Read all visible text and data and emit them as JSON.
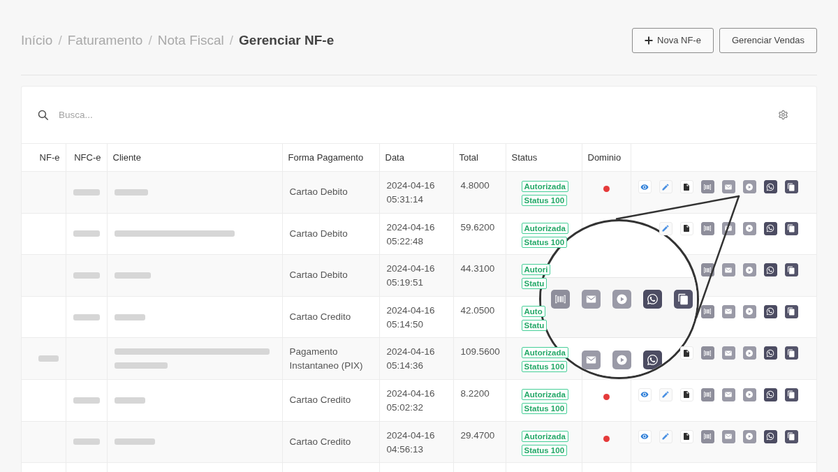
{
  "breadcrumb": [
    {
      "label": "Início",
      "current": false
    },
    {
      "label": "Faturamento",
      "current": false
    },
    {
      "label": "Nota Fiscal",
      "current": false
    },
    {
      "label": "Gerenciar NF-e",
      "current": true
    }
  ],
  "breadcrumb_separator": "/",
  "header_buttons": [
    {
      "kind": "add",
      "label": "Nova NF-e"
    },
    {
      "kind": "plain",
      "label": "Gerenciar Vendas"
    }
  ],
  "search": {
    "placeholder": "Busca..."
  },
  "table": {
    "columns": [
      "NF-e",
      "NFC-e",
      "Cliente",
      "Forma Pagamento",
      "Data",
      "Total",
      "Status",
      "Dominio"
    ],
    "rows": [
      {
        "nfce_redacted": true,
        "client_redacted": true,
        "payment": "Cartao Debito",
        "date": "2024-04-16",
        "time": "05:31:14",
        "total": "4.8000",
        "status": [
          "Autorizada",
          "Status 100"
        ],
        "dominio_dot": true,
        "actions": [
          {
            "kind": "view"
          },
          {
            "kind": "edit"
          },
          {
            "kind": "document"
          },
          {
            "kind": "barcode"
          },
          {
            "kind": "email"
          },
          {
            "kind": "play"
          },
          {
            "kind": "whatsapp"
          },
          {
            "kind": "copy"
          }
        ]
      },
      {
        "nfce_redacted": true,
        "client_redacted": true,
        "payment": "Cartao Debito",
        "date": "2024-04-16",
        "time": "05:22:48",
        "total": "59.6200",
        "status": [
          "Autorizada",
          "Status 100"
        ],
        "actions": [
          {
            "kind": "edit"
          },
          {
            "kind": "document"
          },
          {
            "kind": "barcode"
          },
          {
            "kind": "email"
          },
          {
            "kind": "play"
          },
          {
            "kind": "whatsapp"
          },
          {
            "kind": "copy"
          }
        ]
      },
      {
        "nfce_redacted": true,
        "client_redacted": true,
        "payment": "Cartao Debito",
        "date": "2024-04-16",
        "time": "05:19:51",
        "total": "44.3100",
        "status": [
          "Autori",
          "Statu"
        ],
        "actions": [
          {
            "kind": "barcode"
          },
          {
            "kind": "email"
          },
          {
            "kind": "play"
          },
          {
            "kind": "whatsapp"
          },
          {
            "kind": "copy"
          }
        ]
      },
      {
        "nfce_redacted": true,
        "client_redacted": true,
        "payment": "Cartao Credito",
        "date": "2024-04-16",
        "time": "05:14:50",
        "total": "42.0500",
        "status": [
          "Auto",
          "Statu"
        ],
        "actions": [
          {
            "kind": "barcode"
          },
          {
            "kind": "email"
          },
          {
            "kind": "play"
          },
          {
            "kind": "whatsapp"
          },
          {
            "kind": "copy"
          }
        ]
      },
      {
        "nfe_redacted": true,
        "client_redacted": true,
        "payment": "Pagamento Instantaneo (PIX)",
        "date": "2024-04-16",
        "time": "05:14:36",
        "total": "109.5600",
        "status": [
          "Autorizada",
          "Status 100"
        ],
        "actions": [
          {
            "kind": "document"
          },
          {
            "kind": "barcode"
          },
          {
            "kind": "email"
          },
          {
            "kind": "play"
          },
          {
            "kind": "whatsapp"
          },
          {
            "kind": "copy"
          }
        ]
      },
      {
        "nfce_redacted": true,
        "client_redacted": true,
        "payment": "Cartao Credito",
        "date": "2024-04-16",
        "time": "05:02:32",
        "total": "8.2200",
        "status": [
          "Autorizada",
          "Status 100"
        ],
        "dominio_dot": true,
        "actions": [
          {
            "kind": "view"
          },
          {
            "kind": "edit"
          },
          {
            "kind": "document"
          },
          {
            "kind": "barcode"
          },
          {
            "kind": "email"
          },
          {
            "kind": "play"
          },
          {
            "kind": "whatsapp"
          },
          {
            "kind": "copy"
          }
        ]
      },
      {
        "nfce_redacted": true,
        "client_redacted": true,
        "payment": "Cartao Credito",
        "date": "2024-04-16",
        "time": "04:56:13",
        "total": "29.4700",
        "status": [
          "Autorizada",
          "Status 100"
        ],
        "dominio_dot": true,
        "actions": [
          {
            "kind": "view"
          },
          {
            "kind": "edit"
          },
          {
            "kind": "document"
          },
          {
            "kind": "barcode"
          },
          {
            "kind": "email"
          },
          {
            "kind": "play"
          },
          {
            "kind": "whatsapp"
          },
          {
            "kind": "copy"
          }
        ]
      }
    ]
  },
  "magnifier": {
    "rows": [
      {
        "icons": [
          {
            "kind": "barcode"
          },
          {
            "kind": "email"
          },
          {
            "kind": "play"
          },
          {
            "kind": "whatsapp"
          },
          {
            "kind": "copy"
          }
        ]
      },
      {
        "icons": [
          {
            "kind": "email"
          },
          {
            "kind": "play"
          },
          {
            "kind": "whatsapp"
          }
        ]
      }
    ]
  }
}
